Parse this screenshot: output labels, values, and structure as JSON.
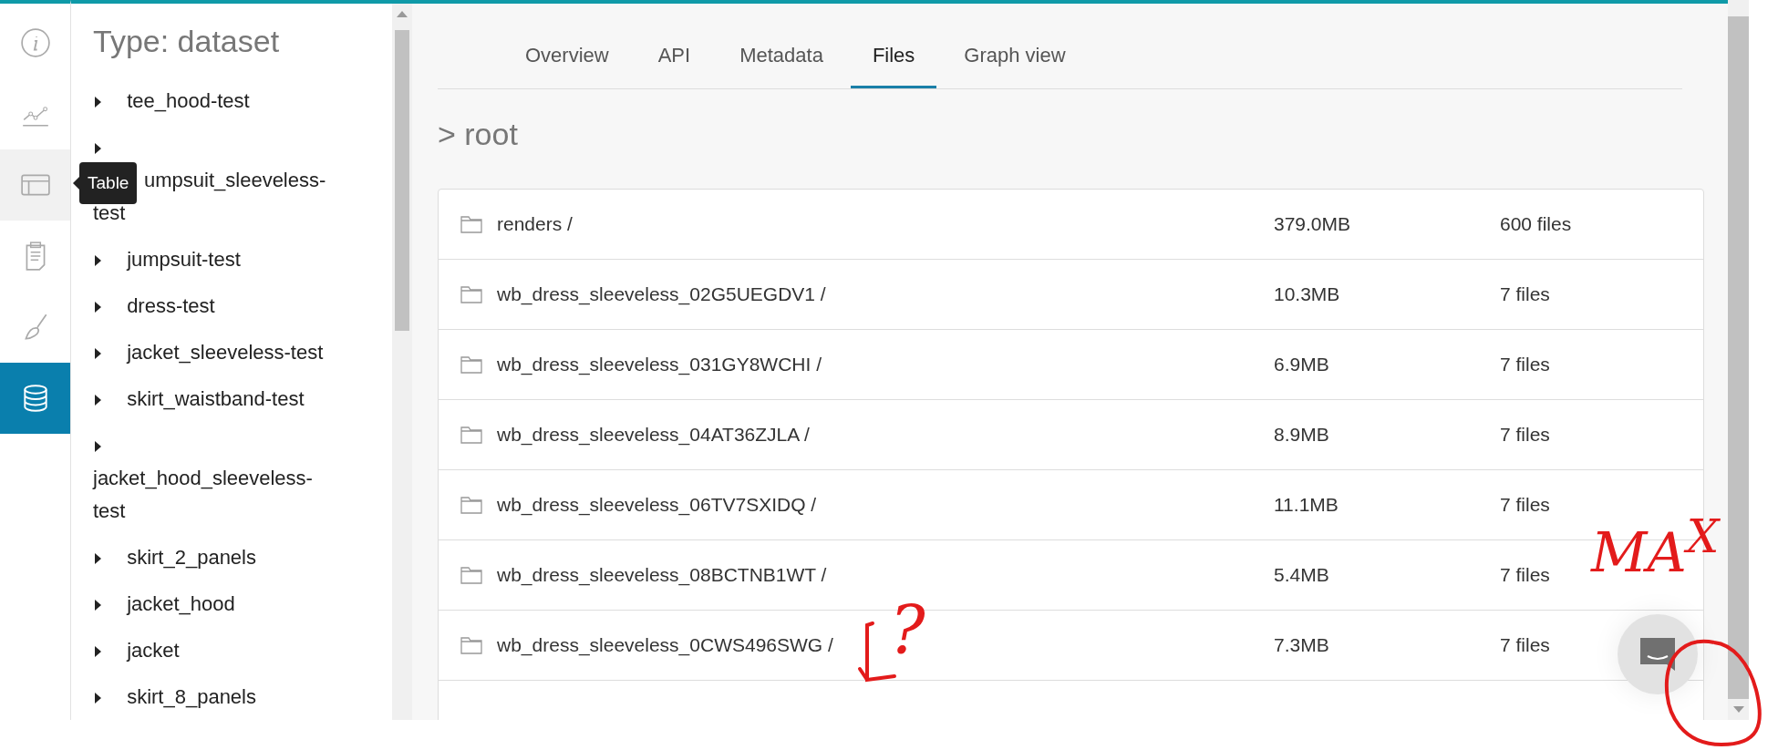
{
  "nav_rail": {
    "items": [
      {
        "kind": "info",
        "selected": false,
        "hovered": false
      },
      {
        "kind": "chart",
        "selected": false,
        "hovered": false
      },
      {
        "kind": "table",
        "selected": false,
        "hovered": true
      },
      {
        "kind": "clipboard",
        "selected": false,
        "hovered": false
      },
      {
        "kind": "brush",
        "selected": false,
        "hovered": false
      },
      {
        "kind": "database",
        "selected": true,
        "hovered": false
      }
    ],
    "tooltip": "Table"
  },
  "sidebar": {
    "title": "Type: dataset",
    "items": [
      {
        "label": "tee_hood-test",
        "expanded": false
      },
      {
        "label": "umpsuit_sleeveless-test",
        "expanded": false,
        "under_tooltip": true
      },
      {
        "label": "jumpsuit-test",
        "expanded": false
      },
      {
        "label": "dress-test",
        "expanded": false
      },
      {
        "label": "jacket_sleeveless-test",
        "expanded": false
      },
      {
        "label": "skirt_waistband-test",
        "expanded": false
      },
      {
        "label": "jacket_hood_sleeveless-test",
        "expanded": false
      },
      {
        "label": "skirt_2_panels",
        "expanded": false
      },
      {
        "label": "jacket_hood",
        "expanded": false
      },
      {
        "label": "jacket",
        "expanded": false
      },
      {
        "label": "skirt_8_panels",
        "expanded": false
      }
    ]
  },
  "tabs": [
    {
      "label": "Overview",
      "selected": false
    },
    {
      "label": "API",
      "selected": false
    },
    {
      "label": "Metadata",
      "selected": false
    },
    {
      "label": "Files",
      "selected": true
    },
    {
      "label": "Graph view",
      "selected": false
    }
  ],
  "breadcrumb": "> root",
  "files": [
    {
      "name": "renders /",
      "size": "379.0MB",
      "count": "600 files"
    },
    {
      "name": "wb_dress_sleeveless_02G5UEGDV1 /",
      "size": "10.3MB",
      "count": "7 files"
    },
    {
      "name": "wb_dress_sleeveless_031GY8WCHI /",
      "size": "6.9MB",
      "count": "7 files"
    },
    {
      "name": "wb_dress_sleeveless_04AT36ZJLA /",
      "size": "8.9MB",
      "count": "7 files"
    },
    {
      "name": "wb_dress_sleeveless_06TV7SXIDQ /",
      "size": "11.1MB",
      "count": "7 files"
    },
    {
      "name": "wb_dress_sleeveless_08BCTNB1WT /",
      "size": "5.4MB",
      "count": "7 files"
    },
    {
      "name": "wb_dress_sleeveless_0CWS496SWG /",
      "size": "7.3MB",
      "count": "7 files"
    }
  ],
  "annotations": [
    {
      "kind": "text",
      "text": "MA$^{X}$"
    },
    {
      "kind": "text",
      "text": "?"
    },
    {
      "kind": "arrow"
    },
    {
      "kind": "circle"
    }
  ]
}
